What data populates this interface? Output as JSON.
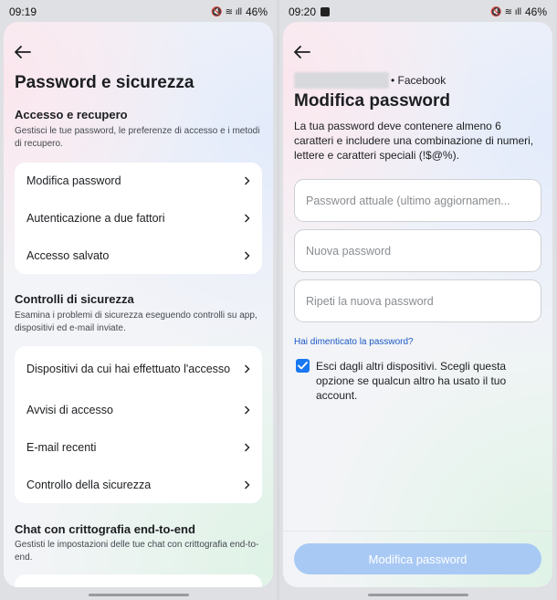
{
  "left": {
    "status": {
      "time": "09:19",
      "battery": "46%",
      "icons": "🔇 ≋ ıll"
    },
    "title": "Password e sicurezza",
    "sections": [
      {
        "heading": "Accesso e recupero",
        "description": "Gestisci le tue password, le preferenze di accesso e i metodi di recupero.",
        "items": [
          {
            "label": "Modifica password"
          },
          {
            "label": "Autenticazione a due fattori"
          },
          {
            "label": "Accesso salvato"
          }
        ]
      },
      {
        "heading": "Controlli di sicurezza",
        "description": "Esamina i problemi di sicurezza eseguendo controlli su app, dispositivi ed e-mail inviate.",
        "items": [
          {
            "label": "Dispositivi da cui hai effettuato l'accesso"
          },
          {
            "label": "Avvisi di accesso"
          },
          {
            "label": "E-mail recenti"
          },
          {
            "label": "Controllo della sicurezza"
          }
        ]
      },
      {
        "heading": "Chat con crittografia end-to-end",
        "description": "Gestisti le impostazioni delle tue chat con crittografia end-to-end."
      }
    ]
  },
  "right": {
    "status": {
      "time": "09:20",
      "battery": "46%",
      "icons": "🔇 ≋ ıll"
    },
    "account_suffix": "• Facebook",
    "title": "Modifica password",
    "description": "La tua password deve contenere almeno 6 caratteri e includere una combinazione di numeri, lettere e caratteri speciali (!$@%).",
    "fields": {
      "current": {
        "placeholder": "Password attuale (ultimo aggiornamen...",
        "value": ""
      },
      "new": {
        "placeholder": "Nuova password",
        "value": ""
      },
      "repeat": {
        "placeholder": "Ripeti la nuova password",
        "value": ""
      }
    },
    "forgot_link": "Hai dimenticato la password?",
    "logout_option": {
      "checked": true,
      "label": "Esci dagli altri dispositivi. Scegli questa opzione se qualcun altro ha usato il tuo account."
    },
    "submit_label": "Modifica password"
  },
  "colors": {
    "accent": "#1877f2",
    "link": "#1a58c4",
    "button_disabled": "#a9c9f5",
    "card": "#ffffff"
  }
}
